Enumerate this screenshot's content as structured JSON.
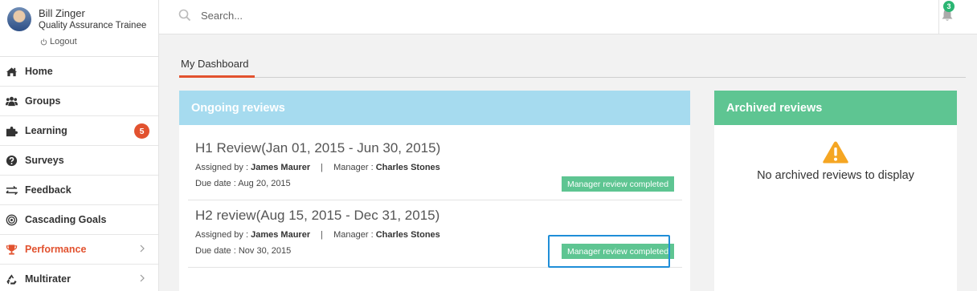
{
  "user": {
    "name": "Bill Zinger",
    "role": "Quality Assurance Trainee",
    "logout_label": "Logout"
  },
  "sidebar": {
    "items": [
      {
        "label": "Home",
        "icon": "home-icon"
      },
      {
        "label": "Groups",
        "icon": "users-icon"
      },
      {
        "label": "Learning",
        "icon": "puzzle-icon",
        "badge": "5"
      },
      {
        "label": "Surveys",
        "icon": "question-icon"
      },
      {
        "label": "Feedback",
        "icon": "exchange-icon"
      },
      {
        "label": "Cascading Goals",
        "icon": "target-icon"
      },
      {
        "label": "Performance",
        "icon": "trophy-icon",
        "active": true
      },
      {
        "label": "Multirater",
        "icon": "recycle-icon"
      }
    ]
  },
  "search": {
    "placeholder": "Search..."
  },
  "notifications": {
    "count": "3"
  },
  "tabs": {
    "active_label": "My Dashboard"
  },
  "ongoing": {
    "title": "Ongoing reviews",
    "reviews": [
      {
        "title": "H1 Review(Jan 01, 2015 - Jun 30, 2015)",
        "assigned_label": "Assigned by :",
        "assigned_by": "James Maurer",
        "separator": "|",
        "manager_label": "Manager :",
        "manager": "Charles Stones",
        "due_label": "Due date :",
        "due_date": "Aug 20, 2015",
        "status": "Manager review completed"
      },
      {
        "title": "H2 review(Aug 15, 2015 - Dec 31, 2015)",
        "assigned_label": "Assigned by :",
        "assigned_by": "James Maurer",
        "separator": "|",
        "manager_label": "Manager :",
        "manager": "Charles Stones",
        "due_label": "Due date :",
        "due_date": "Nov 30, 2015",
        "status": "Manager review completed"
      }
    ]
  },
  "archived": {
    "title": "Archived reviews",
    "empty_message": "No archived reviews to display"
  },
  "colors": {
    "accent": "#e2522f",
    "ongoing_header": "#a6dbef",
    "archived_header": "#5ec592",
    "status_badge": "#5ec592",
    "notification_badge": "#2bb673",
    "warning": "#f5a623",
    "highlight": "#1f8ed8"
  }
}
